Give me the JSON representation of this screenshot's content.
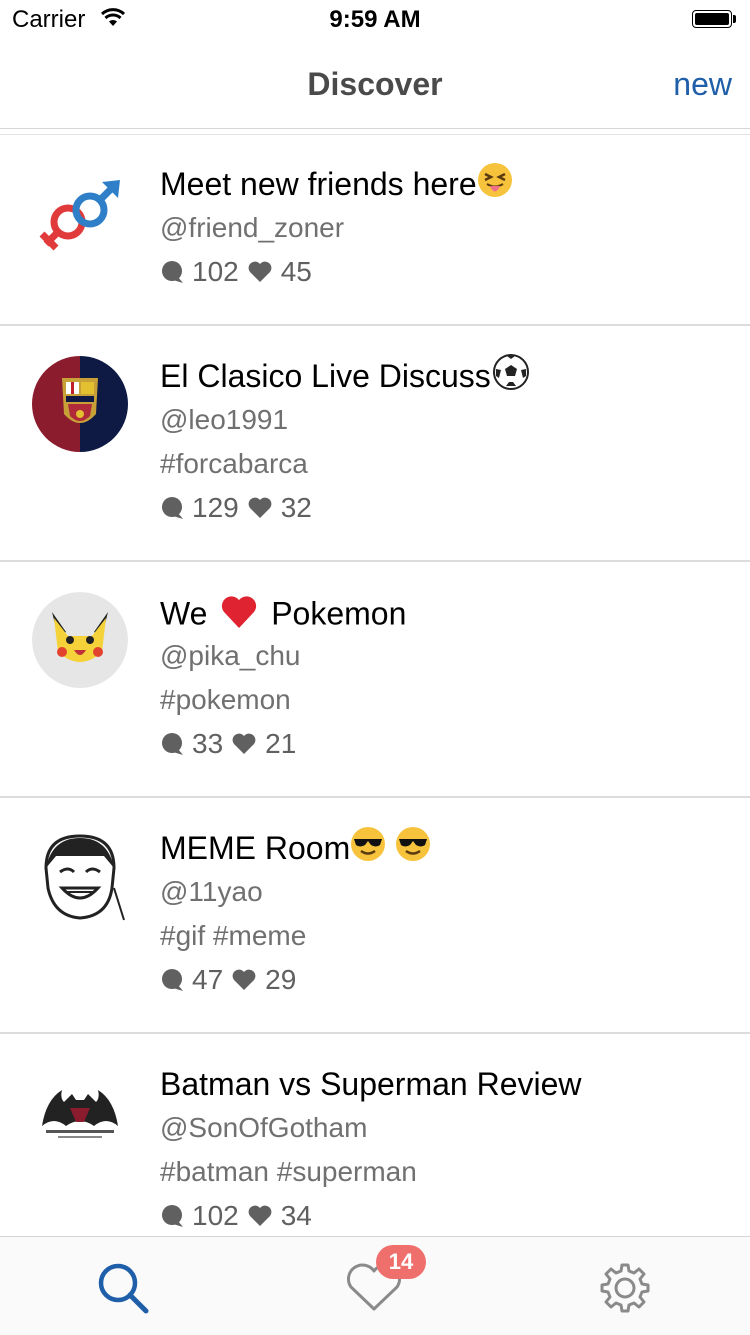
{
  "status_bar": {
    "carrier": "Carrier",
    "time": "9:59 AM"
  },
  "nav": {
    "title": "Discover",
    "new_label": "new"
  },
  "rooms": [
    {
      "title": "Meet new friends here",
      "title_emoji": [
        "squint-tongue-emoji"
      ],
      "user": "@friend_zoner",
      "tags": "",
      "comments": "102",
      "likes": "45",
      "avatar": "gender-symbols-avatar"
    },
    {
      "title": "El Clasico Live Discuss",
      "title_emoji": [
        "soccer-ball-emoji"
      ],
      "user": "@leo1991",
      "tags": "#forcabarca",
      "comments": "129",
      "likes": "32",
      "avatar": "fcb-crest-avatar"
    },
    {
      "title_before": "We",
      "title_after": "Pokemon",
      "title_emoji": [
        "red-heart-emoji"
      ],
      "user": "@pika_chu",
      "tags": "#pokemon",
      "comments": "33",
      "likes": "21",
      "avatar": "pikachu-avatar"
    },
    {
      "title": "MEME Room",
      "title_emoji": [
        "sunglasses-emoji",
        "sunglasses-emoji"
      ],
      "user": "@11yao",
      "tags": "#gif #meme",
      "comments": "47",
      "likes": "29",
      "avatar": "yao-ming-meme-avatar"
    },
    {
      "title": "Batman vs Superman Review",
      "title_emoji": [],
      "user": "@SonOfGotham",
      "tags": "#batman #superman",
      "comments": "102",
      "likes": "34",
      "avatar": "batman-v-superman-logo-avatar"
    }
  ],
  "tab_bar": {
    "badge": "14",
    "tabs": [
      "search-icon",
      "heart-icon",
      "settings-gear-icon"
    ],
    "active_color": "#1f5ea8"
  },
  "colors": {
    "accent": "#1f5ea8",
    "badge": "#ef6f6c",
    "secondary_text": "#707070"
  }
}
